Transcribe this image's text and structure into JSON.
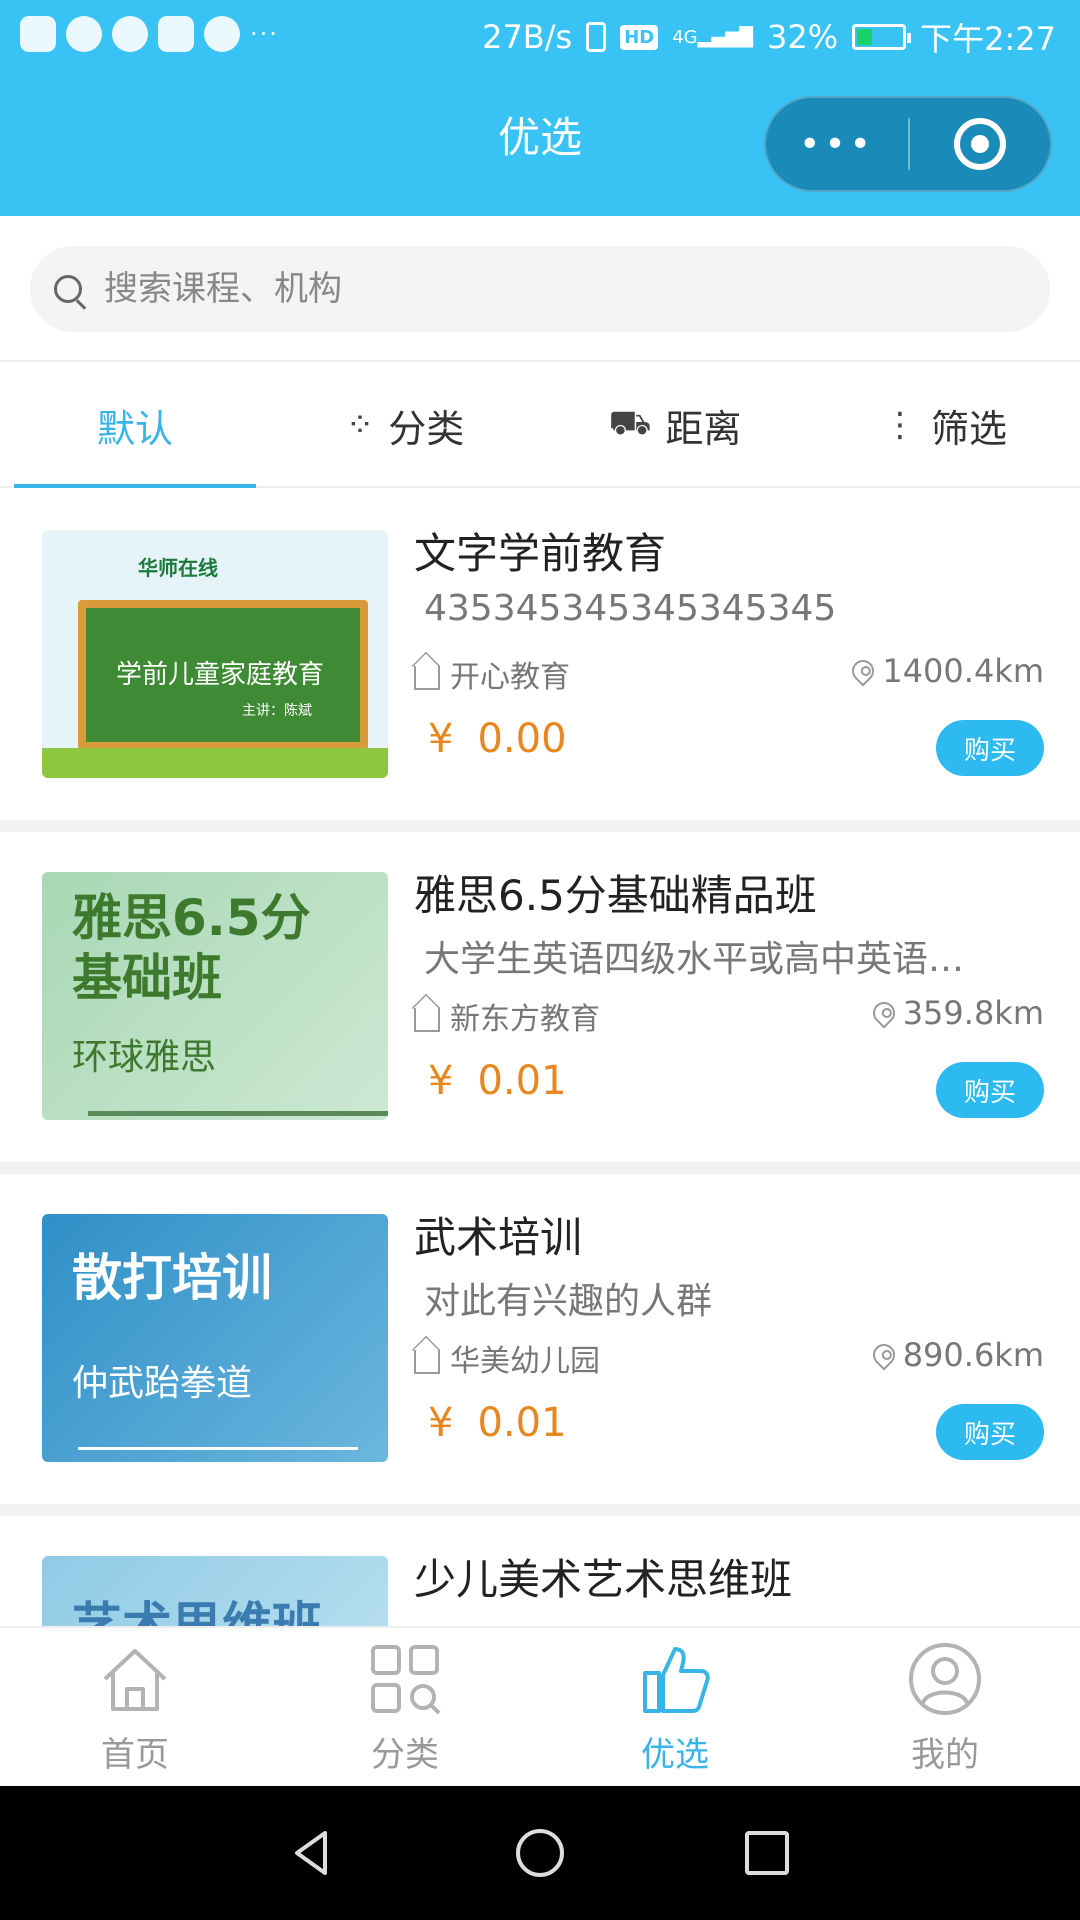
{
  "status_bar": {
    "speed": "27B/s",
    "hd": "HD",
    "network": "4G",
    "battery": "32%",
    "battery_level": 0.32,
    "time": "下午2:27",
    "left_icons": [
      "baidu-icon",
      "bird-icon",
      "play-icon",
      "camera-icon",
      "chat-icon"
    ],
    "more": "···"
  },
  "header": {
    "title": "优选",
    "capsule_more": "•••"
  },
  "search": {
    "placeholder": "搜索课程、机构"
  },
  "tabs": [
    {
      "label": "默认",
      "icon": ""
    },
    {
      "label": "分类",
      "icon": "grid-icon"
    },
    {
      "label": "距离",
      "icon": "car-icon"
    },
    {
      "label": "筛选",
      "icon": "vertical-dots-icon"
    }
  ],
  "tab_icons": {
    "grid": "⁘",
    "car": "⛟",
    "dots": "⋮"
  },
  "courses": [
    {
      "title": "文字学前教育",
      "description": "435345345345345345",
      "org": "开心教育",
      "distance": "1400.4km",
      "currency": "¥",
      "price": "0.00",
      "buy": "购买",
      "thumb_line1": "学前儿童家庭教育",
      "thumb_line2": "主讲：陈斌",
      "thumb_brand": "华师在线"
    },
    {
      "title": "雅思6.5分基础精品班",
      "description": "大学生英语四级水平或高中英语…",
      "org": "新东方教育",
      "distance": "359.8km",
      "currency": "¥",
      "price": "0.01",
      "buy": "购买",
      "thumb_line1": "雅思6.5分",
      "thumb_line1b": "基础班",
      "thumb_line2": "环球雅思"
    },
    {
      "title": "武术培训",
      "description": "对此有兴趣的人群",
      "org": "华美幼儿园",
      "distance": "890.6km",
      "currency": "¥",
      "price": "0.01",
      "buy": "购买",
      "thumb_line1": "散打培训",
      "thumb_line2": "仲武跆拳道"
    },
    {
      "title": "少儿美术艺术思维班",
      "thumb_line1": "艺术思维班"
    }
  ],
  "bottom_tabs": [
    {
      "label": "首页",
      "icon": "home-icon"
    },
    {
      "label": "分类",
      "icon": "category-icon"
    },
    {
      "label": "优选",
      "icon": "thumbs-up-icon"
    },
    {
      "label": "我的",
      "icon": "profile-icon"
    }
  ],
  "colors": {
    "primary": "#39c2f4",
    "active_tab": "#39b4e6",
    "price": "#e8871e",
    "buy_button": "#2cbaf0"
  }
}
